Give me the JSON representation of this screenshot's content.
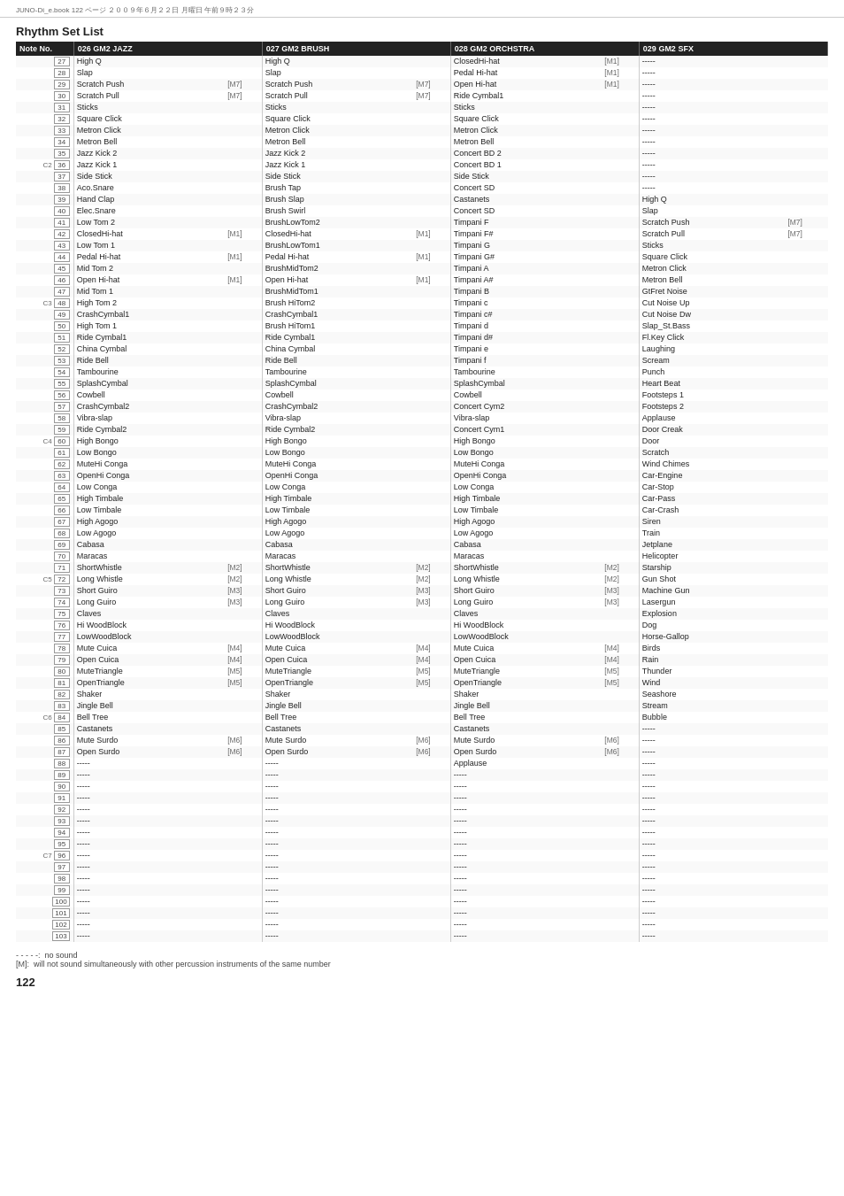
{
  "header": {
    "breadcrumb": "JUNO-Di_e.book  122 ページ  ２００９年６月２２日  月曜日  午前９時２３分",
    "title": "Rhythm Set List",
    "page_number": "122"
  },
  "columns": [
    {
      "id": "note",
      "label": "Note No."
    },
    {
      "id": "jazz",
      "label": "026 GM2 JAZZ"
    },
    {
      "id": "brush",
      "label": "027 GM2 BRUSH"
    },
    {
      "id": "orchstra",
      "label": "028 GM2 ORCHSTRA"
    },
    {
      "id": "sfx",
      "label": "029 GM2 SFX"
    }
  ],
  "rows": [
    {
      "note": "27",
      "octave": "",
      "jazz": "High Q",
      "jazz_tag": "",
      "brush": "High Q",
      "brush_tag": "",
      "orchstra": "ClosedHi-hat",
      "orchstra_tag": "[M1]",
      "sfx": "-----"
    },
    {
      "note": "28",
      "octave": "",
      "jazz": "Slap",
      "jazz_tag": "",
      "brush": "Slap",
      "brush_tag": "",
      "orchstra": "Pedal Hi-hat",
      "orchstra_tag": "[M1]",
      "sfx": "-----"
    },
    {
      "note": "29",
      "octave": "",
      "jazz": "Scratch Push",
      "jazz_tag": "[M7]",
      "brush": "Scratch Push",
      "brush_tag": "[M7]",
      "orchstra": "Open Hi-hat",
      "orchstra_tag": "[M1]",
      "sfx": "-----"
    },
    {
      "note": "30",
      "octave": "",
      "jazz": "Scratch Pull",
      "jazz_tag": "[M7]",
      "brush": "Scratch Pull",
      "brush_tag": "[M7]",
      "orchstra": "Ride Cymbal1",
      "orchstra_tag": "",
      "sfx": "-----"
    },
    {
      "note": "31",
      "octave": "",
      "jazz": "Sticks",
      "jazz_tag": "",
      "brush": "Sticks",
      "brush_tag": "",
      "orchstra": "Sticks",
      "orchstra_tag": "",
      "sfx": "-----"
    },
    {
      "note": "32",
      "octave": "",
      "jazz": "Square Click",
      "jazz_tag": "",
      "brush": "Square Click",
      "brush_tag": "",
      "orchstra": "Square Click",
      "orchstra_tag": "",
      "sfx": "-----"
    },
    {
      "note": "33",
      "octave": "",
      "jazz": "Metron Click",
      "jazz_tag": "",
      "brush": "Metron Click",
      "brush_tag": "",
      "orchstra": "Metron Click",
      "orchstra_tag": "",
      "sfx": "-----"
    },
    {
      "note": "34",
      "octave": "",
      "jazz": "Metron Bell",
      "jazz_tag": "",
      "brush": "Metron Bell",
      "brush_tag": "",
      "orchstra": "Metron Bell",
      "orchstra_tag": "",
      "sfx": "-----"
    },
    {
      "note": "35",
      "octave": "",
      "jazz": "Jazz Kick 2",
      "jazz_tag": "",
      "brush": "Jazz Kick 2",
      "brush_tag": "",
      "orchstra": "Concert BD 2",
      "orchstra_tag": "",
      "sfx": "-----"
    },
    {
      "note": "36",
      "octave": "C2",
      "jazz": "Jazz Kick 1",
      "jazz_tag": "",
      "brush": "Jazz Kick 1",
      "brush_tag": "",
      "orchstra": "Concert BD 1",
      "orchstra_tag": "",
      "sfx": "-----"
    },
    {
      "note": "37",
      "octave": "",
      "jazz": "Side Stick",
      "jazz_tag": "",
      "brush": "Side Stick",
      "brush_tag": "",
      "orchstra": "Side Stick",
      "orchstra_tag": "",
      "sfx": "-----"
    },
    {
      "note": "38",
      "octave": "",
      "jazz": "Aco.Snare",
      "jazz_tag": "",
      "brush": "Brush Tap",
      "brush_tag": "",
      "orchstra": "Concert SD",
      "orchstra_tag": "",
      "sfx": "-----"
    },
    {
      "note": "39",
      "octave": "",
      "jazz": "Hand Clap",
      "jazz_tag": "",
      "brush": "Brush Slap",
      "brush_tag": "",
      "orchstra": "Castanets",
      "orchstra_tag": "",
      "sfx": "High Q"
    },
    {
      "note": "40",
      "octave": "",
      "jazz": "Elec.Snare",
      "jazz_tag": "",
      "brush": "Brush Swirl",
      "brush_tag": "",
      "orchstra": "Concert SD",
      "orchstra_tag": "",
      "sfx": "Slap"
    },
    {
      "note": "41",
      "octave": "",
      "jazz": "Low Tom 2",
      "jazz_tag": "",
      "brush": "BrushLowTom2",
      "brush_tag": "",
      "orchstra": "Timpani F",
      "orchstra_tag": "",
      "sfx": "Scratch Push",
      "sfx_tag": "[M7]"
    },
    {
      "note": "42",
      "octave": "",
      "jazz": "ClosedHi-hat",
      "jazz_tag": "[M1]",
      "brush": "ClosedHi-hat",
      "brush_tag": "[M1]",
      "orchstra": "Timpani F#",
      "orchstra_tag": "",
      "sfx": "Scratch Pull",
      "sfx_tag": "[M7]"
    },
    {
      "note": "43",
      "octave": "",
      "jazz": "Low Tom 1",
      "jazz_tag": "",
      "brush": "BrushLowTom1",
      "brush_tag": "",
      "orchstra": "Timpani G",
      "orchstra_tag": "",
      "sfx": "Sticks"
    },
    {
      "note": "44",
      "octave": "",
      "jazz": "Pedal Hi-hat",
      "jazz_tag": "[M1]",
      "brush": "Pedal Hi-hat",
      "brush_tag": "[M1]",
      "orchstra": "Timpani G#",
      "orchstra_tag": "",
      "sfx": "Square Click"
    },
    {
      "note": "45",
      "octave": "",
      "jazz": "Mid Tom 2",
      "jazz_tag": "",
      "brush": "BrushMidTom2",
      "brush_tag": "",
      "orchstra": "Timpani A",
      "orchstra_tag": "",
      "sfx": "Metron Click"
    },
    {
      "note": "46",
      "octave": "",
      "jazz": "Open Hi-hat",
      "jazz_tag": "[M1]",
      "brush": "Open Hi-hat",
      "brush_tag": "[M1]",
      "orchstra": "Timpani A#",
      "orchstra_tag": "",
      "sfx": "Metron Bell"
    },
    {
      "note": "47",
      "octave": "",
      "jazz": "Mid Tom 1",
      "jazz_tag": "",
      "brush": "BrushMidTom1",
      "brush_tag": "",
      "orchstra": "Timpani B",
      "orchstra_tag": "",
      "sfx": "GtFret Noise"
    },
    {
      "note": "48",
      "octave": "C3",
      "jazz": "High Tom 2",
      "jazz_tag": "",
      "brush": "Brush HiTom2",
      "brush_tag": "",
      "orchstra": "Timpani c",
      "orchstra_tag": "",
      "sfx": "Cut Noise Up"
    },
    {
      "note": "49",
      "octave": "",
      "jazz": "CrashCymbal1",
      "jazz_tag": "",
      "brush": "CrashCymbal1",
      "brush_tag": "",
      "orchstra": "Timpani c#",
      "orchstra_tag": "",
      "sfx": "Cut Noise Dw"
    },
    {
      "note": "50",
      "octave": "",
      "jazz": "High Tom 1",
      "jazz_tag": "",
      "brush": "Brush HiTom1",
      "brush_tag": "",
      "orchstra": "Timpani d",
      "orchstra_tag": "",
      "sfx": "Slap_St.Bass"
    },
    {
      "note": "51",
      "octave": "",
      "jazz": "Ride Cymbal1",
      "jazz_tag": "",
      "brush": "Ride Cymbal1",
      "brush_tag": "",
      "orchstra": "Timpani d#",
      "orchstra_tag": "",
      "sfx": "Fl.Key Click"
    },
    {
      "note": "52",
      "octave": "",
      "jazz": "China Cymbal",
      "jazz_tag": "",
      "brush": "China Cymbal",
      "brush_tag": "",
      "orchstra": "Timpani e",
      "orchstra_tag": "",
      "sfx": "Laughing"
    },
    {
      "note": "53",
      "octave": "",
      "jazz": "Ride Bell",
      "jazz_tag": "",
      "brush": "Ride Bell",
      "brush_tag": "",
      "orchstra": "Timpani f",
      "orchstra_tag": "",
      "sfx": "Scream"
    },
    {
      "note": "54",
      "octave": "",
      "jazz": "Tambourine",
      "jazz_tag": "",
      "brush": "Tambourine",
      "brush_tag": "",
      "orchstra": "Tambourine",
      "orchstra_tag": "",
      "sfx": "Punch"
    },
    {
      "note": "55",
      "octave": "",
      "jazz": "SplashCymbal",
      "jazz_tag": "",
      "brush": "SplashCymbal",
      "brush_tag": "",
      "orchstra": "SplashCymbal",
      "orchstra_tag": "",
      "sfx": "Heart Beat"
    },
    {
      "note": "56",
      "octave": "",
      "jazz": "Cowbell",
      "jazz_tag": "",
      "brush": "Cowbell",
      "brush_tag": "",
      "orchstra": "Cowbell",
      "orchstra_tag": "",
      "sfx": "Footsteps 1"
    },
    {
      "note": "57",
      "octave": "",
      "jazz": "CrashCymbal2",
      "jazz_tag": "",
      "brush": "CrashCymbal2",
      "brush_tag": "",
      "orchstra": "Concert Cym2",
      "orchstra_tag": "",
      "sfx": "Footsteps 2"
    },
    {
      "note": "58",
      "octave": "",
      "jazz": "Vibra-slap",
      "jazz_tag": "",
      "brush": "Vibra-slap",
      "brush_tag": "",
      "orchstra": "Vibra-slap",
      "orchstra_tag": "",
      "sfx": "Applause"
    },
    {
      "note": "59",
      "octave": "",
      "jazz": "Ride Cymbal2",
      "jazz_tag": "",
      "brush": "Ride Cymbal2",
      "brush_tag": "",
      "orchstra": "Concert Cym1",
      "orchstra_tag": "",
      "sfx": "Door Creak"
    },
    {
      "note": "60",
      "octave": "C4",
      "jazz": "High Bongo",
      "jazz_tag": "",
      "brush": "High Bongo",
      "brush_tag": "",
      "orchstra": "High Bongo",
      "orchstra_tag": "",
      "sfx": "Door"
    },
    {
      "note": "61",
      "octave": "",
      "jazz": "Low Bongo",
      "jazz_tag": "",
      "brush": "Low Bongo",
      "brush_tag": "",
      "orchstra": "Low Bongo",
      "orchstra_tag": "",
      "sfx": "Scratch"
    },
    {
      "note": "62",
      "octave": "",
      "jazz": "MuteHi Conga",
      "jazz_tag": "",
      "brush": "MuteHi Conga",
      "brush_tag": "",
      "orchstra": "MuteHi Conga",
      "orchstra_tag": "",
      "sfx": "Wind Chimes"
    },
    {
      "note": "63",
      "octave": "",
      "jazz": "OpenHi Conga",
      "jazz_tag": "",
      "brush": "OpenHi Conga",
      "brush_tag": "",
      "orchstra": "OpenHi Conga",
      "orchstra_tag": "",
      "sfx": "Car-Engine"
    },
    {
      "note": "64",
      "octave": "",
      "jazz": "Low Conga",
      "jazz_tag": "",
      "brush": "Low Conga",
      "brush_tag": "",
      "orchstra": "Low Conga",
      "orchstra_tag": "",
      "sfx": "Car-Stop"
    },
    {
      "note": "65",
      "octave": "",
      "jazz": "High Timbale",
      "jazz_tag": "",
      "brush": "High Timbale",
      "brush_tag": "",
      "orchstra": "High Timbale",
      "orchstra_tag": "",
      "sfx": "Car-Pass"
    },
    {
      "note": "66",
      "octave": "",
      "jazz": "Low Timbale",
      "jazz_tag": "",
      "brush": "Low Timbale",
      "brush_tag": "",
      "orchstra": "Low Timbale",
      "orchstra_tag": "",
      "sfx": "Car-Crash"
    },
    {
      "note": "67",
      "octave": "",
      "jazz": "High Agogo",
      "jazz_tag": "",
      "brush": "High Agogo",
      "brush_tag": "",
      "orchstra": "High Agogo",
      "orchstra_tag": "",
      "sfx": "Siren"
    },
    {
      "note": "68",
      "octave": "",
      "jazz": "Low Agogo",
      "jazz_tag": "",
      "brush": "Low Agogo",
      "brush_tag": "",
      "orchstra": "Low Agogo",
      "orchstra_tag": "",
      "sfx": "Train"
    },
    {
      "note": "69",
      "octave": "",
      "jazz": "Cabasa",
      "jazz_tag": "",
      "brush": "Cabasa",
      "brush_tag": "",
      "orchstra": "Cabasa",
      "orchstra_tag": "",
      "sfx": "Jetplane"
    },
    {
      "note": "70",
      "octave": "",
      "jazz": "Maracas",
      "jazz_tag": "",
      "brush": "Maracas",
      "brush_tag": "",
      "orchstra": "Maracas",
      "orchstra_tag": "",
      "sfx": "Helicopter"
    },
    {
      "note": "71",
      "octave": "",
      "jazz": "ShortWhistle",
      "jazz_tag": "[M2]",
      "brush": "ShortWhistle",
      "brush_tag": "[M2]",
      "orchstra": "ShortWhistle",
      "orchstra_tag": "[M2]",
      "sfx": "Starship"
    },
    {
      "note": "72",
      "octave": "C5",
      "jazz": "Long Whistle",
      "jazz_tag": "[M2]",
      "brush": "Long Whistle",
      "brush_tag": "[M2]",
      "orchstra": "Long Whistle",
      "orchstra_tag": "[M2]",
      "sfx": "Gun Shot"
    },
    {
      "note": "73",
      "octave": "",
      "jazz": "Short Guiro",
      "jazz_tag": "[M3]",
      "brush": "Short Guiro",
      "brush_tag": "[M3]",
      "orchstra": "Short Guiro",
      "orchstra_tag": "[M3]",
      "sfx": "Machine Gun"
    },
    {
      "note": "74",
      "octave": "",
      "jazz": "Long Guiro",
      "jazz_tag": "[M3]",
      "brush": "Long Guiro",
      "brush_tag": "[M3]",
      "orchstra": "Long Guiro",
      "orchstra_tag": "[M3]",
      "sfx": "Lasergun"
    },
    {
      "note": "75",
      "octave": "",
      "jazz": "Claves",
      "jazz_tag": "",
      "brush": "Claves",
      "brush_tag": "",
      "orchstra": "Claves",
      "orchstra_tag": "",
      "sfx": "Explosion"
    },
    {
      "note": "76",
      "octave": "",
      "jazz": "Hi WoodBlock",
      "jazz_tag": "",
      "brush": "Hi WoodBlock",
      "brush_tag": "",
      "orchstra": "Hi WoodBlock",
      "orchstra_tag": "",
      "sfx": "Dog"
    },
    {
      "note": "77",
      "octave": "",
      "jazz": "LowWoodBlock",
      "jazz_tag": "",
      "brush": "LowWoodBlock",
      "brush_tag": "",
      "orchstra": "LowWoodBlock",
      "orchstra_tag": "",
      "sfx": "Horse-Gallop"
    },
    {
      "note": "78",
      "octave": "",
      "jazz": "Mute Cuica",
      "jazz_tag": "[M4]",
      "brush": "Mute Cuica",
      "brush_tag": "[M4]",
      "orchstra": "Mute Cuica",
      "orchstra_tag": "[M4]",
      "sfx": "Birds"
    },
    {
      "note": "79",
      "octave": "",
      "jazz": "Open Cuica",
      "jazz_tag": "[M4]",
      "brush": "Open Cuica",
      "brush_tag": "[M4]",
      "orchstra": "Open Cuica",
      "orchstra_tag": "[M4]",
      "sfx": "Rain"
    },
    {
      "note": "80",
      "octave": "",
      "jazz": "MuteTriangle",
      "jazz_tag": "[M5]",
      "brush": "MuteTriangle",
      "brush_tag": "[M5]",
      "orchstra": "MuteTriangle",
      "orchstra_tag": "[M5]",
      "sfx": "Thunder"
    },
    {
      "note": "81",
      "octave": "",
      "jazz": "OpenTriangle",
      "jazz_tag": "[M5]",
      "brush": "OpenTriangle",
      "brush_tag": "[M5]",
      "orchstra": "OpenTriangle",
      "orchstra_tag": "[M5]",
      "sfx": "Wind"
    },
    {
      "note": "82",
      "octave": "",
      "jazz": "Shaker",
      "jazz_tag": "",
      "brush": "Shaker",
      "brush_tag": "",
      "orchstra": "Shaker",
      "orchstra_tag": "",
      "sfx": "Seashore"
    },
    {
      "note": "83",
      "octave": "",
      "jazz": "Jingle Bell",
      "jazz_tag": "",
      "brush": "Jingle Bell",
      "brush_tag": "",
      "orchstra": "Jingle Bell",
      "orchstra_tag": "",
      "sfx": "Stream"
    },
    {
      "note": "84",
      "octave": "C6",
      "jazz": "Bell Tree",
      "jazz_tag": "",
      "brush": "Bell Tree",
      "brush_tag": "",
      "orchstra": "Bell Tree",
      "orchstra_tag": "",
      "sfx": "Bubble"
    },
    {
      "note": "85",
      "octave": "",
      "jazz": "Castanets",
      "jazz_tag": "",
      "brush": "Castanets",
      "brush_tag": "",
      "orchstra": "Castanets",
      "orchstra_tag": "",
      "sfx": "-----"
    },
    {
      "note": "86",
      "octave": "",
      "jazz": "Mute Surdo",
      "jazz_tag": "[M6]",
      "brush": "Mute Surdo",
      "brush_tag": "[M6]",
      "orchstra": "Mute Surdo",
      "orchstra_tag": "[M6]",
      "sfx": "-----"
    },
    {
      "note": "87",
      "octave": "",
      "jazz": "Open Surdo",
      "jazz_tag": "[M6]",
      "brush": "Open Surdo",
      "brush_tag": "[M6]",
      "orchstra": "Open Surdo",
      "orchstra_tag": "[M6]",
      "sfx": "-----"
    },
    {
      "note": "88",
      "octave": "",
      "jazz": "-----",
      "jazz_tag": "",
      "brush": "-----",
      "brush_tag": "",
      "orchstra": "Applause",
      "orchstra_tag": "",
      "sfx": "-----"
    },
    {
      "note": "89",
      "octave": "",
      "jazz": "-----",
      "jazz_tag": "",
      "brush": "-----",
      "brush_tag": "",
      "orchstra": "-----",
      "orchstra_tag": "",
      "sfx": "-----"
    },
    {
      "note": "90",
      "octave": "",
      "jazz": "-----",
      "jazz_tag": "",
      "brush": "-----",
      "brush_tag": "",
      "orchstra": "-----",
      "orchstra_tag": "",
      "sfx": "-----"
    },
    {
      "note": "91",
      "octave": "",
      "jazz": "-----",
      "jazz_tag": "",
      "brush": "-----",
      "brush_tag": "",
      "orchstra": "-----",
      "orchstra_tag": "",
      "sfx": "-----"
    },
    {
      "note": "92",
      "octave": "",
      "jazz": "-----",
      "jazz_tag": "",
      "brush": "-----",
      "brush_tag": "",
      "orchstra": "-----",
      "orchstra_tag": "",
      "sfx": "-----"
    },
    {
      "note": "93",
      "octave": "",
      "jazz": "-----",
      "jazz_tag": "",
      "brush": "-----",
      "brush_tag": "",
      "orchstra": "-----",
      "orchstra_tag": "",
      "sfx": "-----"
    },
    {
      "note": "94",
      "octave": "",
      "jazz": "-----",
      "jazz_tag": "",
      "brush": "-----",
      "brush_tag": "",
      "orchstra": "-----",
      "orchstra_tag": "",
      "sfx": "-----"
    },
    {
      "note": "95",
      "octave": "",
      "jazz": "-----",
      "jazz_tag": "",
      "brush": "-----",
      "brush_tag": "",
      "orchstra": "-----",
      "orchstra_tag": "",
      "sfx": "-----"
    },
    {
      "note": "96",
      "octave": "C7",
      "jazz": "-----",
      "jazz_tag": "",
      "brush": "-----",
      "brush_tag": "",
      "orchstra": "-----",
      "orchstra_tag": "",
      "sfx": "-----"
    },
    {
      "note": "97",
      "octave": "",
      "jazz": "-----",
      "jazz_tag": "",
      "brush": "-----",
      "brush_tag": "",
      "orchstra": "-----",
      "orchstra_tag": "",
      "sfx": "-----"
    },
    {
      "note": "98",
      "octave": "",
      "jazz": "-----",
      "jazz_tag": "",
      "brush": "-----",
      "brush_tag": "",
      "orchstra": "-----",
      "orchstra_tag": "",
      "sfx": "-----"
    },
    {
      "note": "99",
      "octave": "",
      "jazz": "-----",
      "jazz_tag": "",
      "brush": "-----",
      "brush_tag": "",
      "orchstra": "-----",
      "orchstra_tag": "",
      "sfx": "-----"
    },
    {
      "note": "100",
      "octave": "",
      "jazz": "-----",
      "jazz_tag": "",
      "brush": "-----",
      "brush_tag": "",
      "orchstra": "-----",
      "orchstra_tag": "",
      "sfx": "-----"
    },
    {
      "note": "101",
      "octave": "",
      "jazz": "-----",
      "jazz_tag": "",
      "brush": "-----",
      "brush_tag": "",
      "orchstra": "-----",
      "orchstra_tag": "",
      "sfx": "-----"
    },
    {
      "note": "102",
      "octave": "",
      "jazz": "-----",
      "jazz_tag": "",
      "brush": "-----",
      "brush_tag": "",
      "orchstra": "-----",
      "orchstra_tag": "",
      "sfx": "-----"
    },
    {
      "note": "103",
      "octave": "",
      "jazz": "-----",
      "jazz_tag": "",
      "brush": "-----",
      "brush_tag": "",
      "orchstra": "-----",
      "orchstra_tag": "",
      "sfx": "-----"
    }
  ],
  "footer": {
    "no_sound_label": "- - - - -:",
    "no_sound_desc": "no sound",
    "m_label": "[M]:",
    "m_desc": "will not sound simultaneously with other percussion instruments of the same number",
    "page_num": "122"
  }
}
